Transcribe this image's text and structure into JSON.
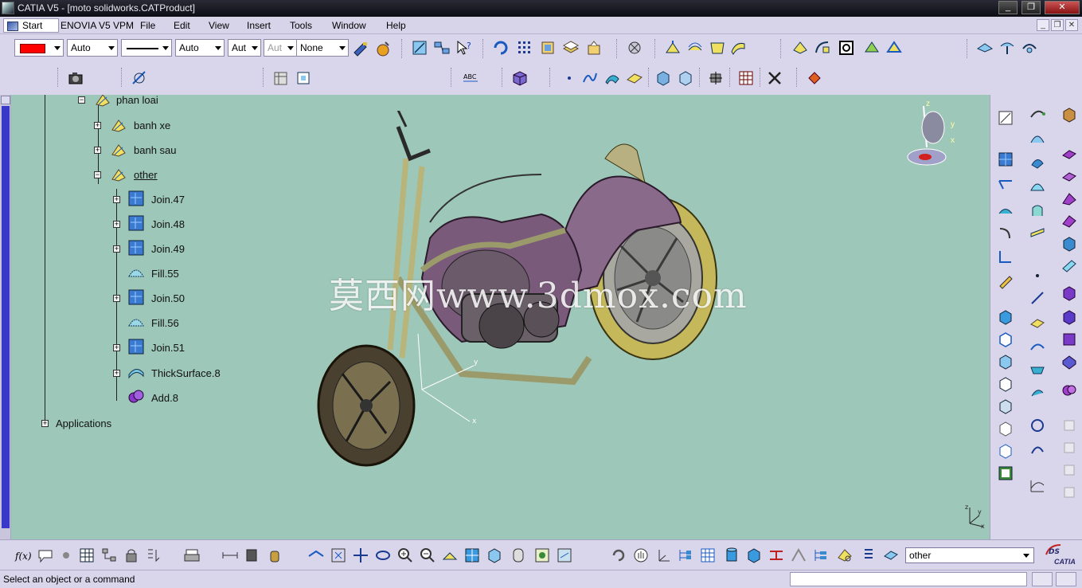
{
  "window": {
    "title": "CATIA V5 - [moto solidworks.CATProduct]",
    "controls": [
      "_",
      "❐",
      "✕"
    ]
  },
  "menubar": {
    "start": "Start",
    "items": [
      "ENOVIA V5 VPM",
      "File",
      "Edit",
      "View",
      "Insert",
      "Tools",
      "Window",
      "Help"
    ]
  },
  "toolbar": {
    "color_value": "",
    "transparency": "Auto",
    "line_weight": "Auto",
    "line_type": "Aut",
    "layer_a": "Aut",
    "layer": "None",
    "accent_color": "#ff0000"
  },
  "tree": {
    "nodes": [
      {
        "label": "phan loai"
      },
      {
        "label": "banh xe"
      },
      {
        "label": "banh sau"
      },
      {
        "label": "other"
      },
      {
        "label": "Join.47"
      },
      {
        "label": "Join.48"
      },
      {
        "label": "Join.49"
      },
      {
        "label": "Fill.55"
      },
      {
        "label": "Join.50"
      },
      {
        "label": "Fill.56"
      },
      {
        "label": "Join.51"
      },
      {
        "label": "ThickSurface.8"
      },
      {
        "label": "Add.8"
      },
      {
        "label": "Applications"
      }
    ]
  },
  "viewport": {
    "watermark": "莫西网www.3dmox.com",
    "background_color": "#9dc7b8"
  },
  "compass": {
    "z": "z",
    "y": "y",
    "x": "x"
  },
  "bottom": {
    "current_object": "other",
    "logo": "CATIA"
  },
  "status": {
    "message": "Select an object or a command"
  }
}
